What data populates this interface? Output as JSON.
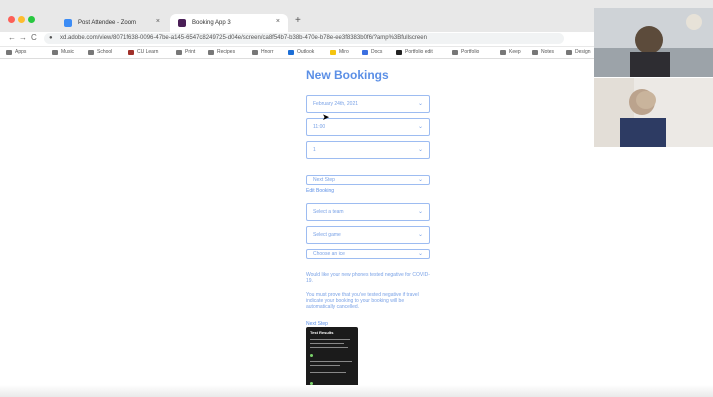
{
  "browser": {
    "tabs": [
      {
        "label": "Post Attendee - Zoom",
        "favicon_color": "#3c8cf5"
      },
      {
        "label": "Booking App 3",
        "favicon_color": "#4a1f57"
      }
    ],
    "new_tab_label": "+",
    "url": "xd.adobe.com/view/8071f638-0096-47be-a145-6547c8249725-d04e/screen/ca8f54b7-b38b-470e-b78e-ee3f8383b0f6/?amp%3Bfullscreen",
    "nav": {
      "back": "←",
      "forward": "→",
      "reload": "C"
    },
    "bookmarks": [
      "Apps",
      "Music",
      "School",
      "CU Learn",
      "Print",
      "Recipes",
      "Hnorr",
      "Outlook",
      "Miro",
      "Docs",
      "Portfolio edit",
      "Portfolio",
      "Keep",
      "Notes",
      "Design"
    ]
  },
  "booking": {
    "title": "New Bookings",
    "fields": [
      "February 24th, 2021",
      "11:00",
      "1",
      "Next Step"
    ],
    "link1": "Edit Booking",
    "fields2": [
      "Select a team",
      "Select game",
      "Choose an ice"
    ],
    "note1": "Would like your new phones tested negative for COVID-19.",
    "note2": "You must prove that you've tested negative if travel indicate your booking to your booking will be automatically cancelled.",
    "link2": "Next Step",
    "phone_title": "Test Results"
  },
  "icons": {
    "lock": "lock-icon",
    "chevron": "chevron-down-icon",
    "cursor": "mouse-cursor-icon"
  },
  "colors": {
    "accent": "#5b8fe6",
    "chrome": "#e8e8e8"
  }
}
